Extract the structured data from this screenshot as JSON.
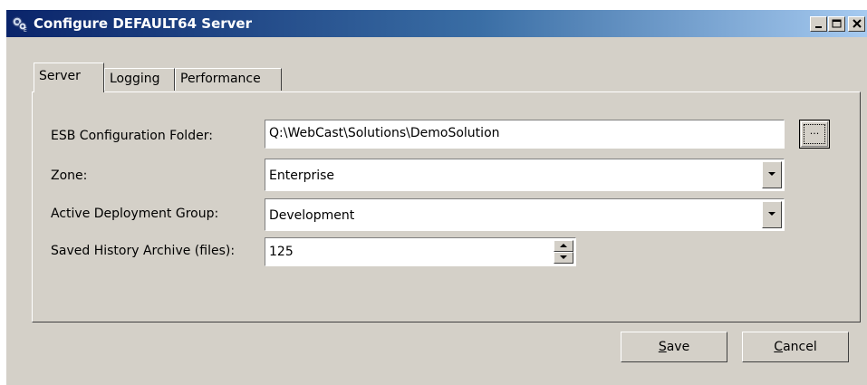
{
  "window": {
    "title": "Configure DEFAULT64 Server",
    "icon": "gears-app-icon",
    "caption_buttons": [
      "minimize",
      "maximize",
      "close"
    ]
  },
  "tabs": [
    {
      "label": "Server",
      "active": true
    },
    {
      "label": "Logging",
      "active": false
    },
    {
      "label": "Performance",
      "active": false
    }
  ],
  "form": {
    "esb_folder": {
      "label": "ESB Configuration Folder:",
      "value": "Q:\\WebCast\\Solutions\\DemoSolution",
      "browse_label": "..."
    },
    "zone": {
      "label": "Zone:",
      "value": "Enterprise"
    },
    "deployment_group": {
      "label": "Active Deployment Group:",
      "value": "Development"
    },
    "history_archive": {
      "label": "Saved History Archive (files):",
      "value": "125"
    }
  },
  "buttons": {
    "save": {
      "mnemonic": "S",
      "rest": "ave"
    },
    "cancel": {
      "mnemonic": "C",
      "rest": "ancel"
    }
  },
  "colors": {
    "titlebar_start": "#0a246a",
    "titlebar_end": "#a6caf0",
    "face": "#d4d0c8"
  }
}
